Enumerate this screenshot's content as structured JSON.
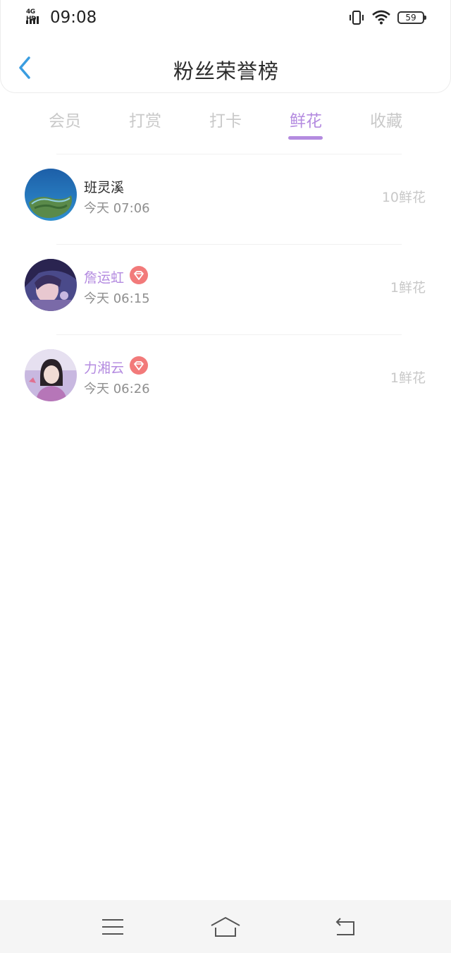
{
  "status_bar": {
    "network": "4G HD",
    "time": "09:08",
    "battery": "59",
    "icons": [
      "signal-icon",
      "vibrate-icon",
      "wifi-icon",
      "battery-icon"
    ]
  },
  "header": {
    "back_icon": "chevron-left-icon",
    "title": "粉丝荣誉榜"
  },
  "tabs": [
    {
      "label": "会员",
      "active": false
    },
    {
      "label": "打赏",
      "active": false
    },
    {
      "label": "打卡",
      "active": false
    },
    {
      "label": "鲜花",
      "active": true
    },
    {
      "label": "收藏",
      "active": false
    }
  ],
  "fans": [
    {
      "name": "班灵溪",
      "time": "今天 07:06",
      "count": "10鲜花",
      "vip": false,
      "avatar": "island-photo"
    },
    {
      "name": "詹运虹",
      "time": "今天 06:15",
      "count": "1鲜花",
      "vip": true,
      "avatar": "anime-portrait"
    },
    {
      "name": "力湘云",
      "time": "今天 06:26",
      "count": "1鲜花",
      "vip": true,
      "avatar": "girl-portrait"
    }
  ],
  "nav": {
    "icons": [
      "menu-icon",
      "home-icon",
      "back-icon"
    ]
  },
  "colors": {
    "accent": "#b48be0",
    "back_arrow": "#3a9de0",
    "vip_badge": "#f27a7a"
  }
}
